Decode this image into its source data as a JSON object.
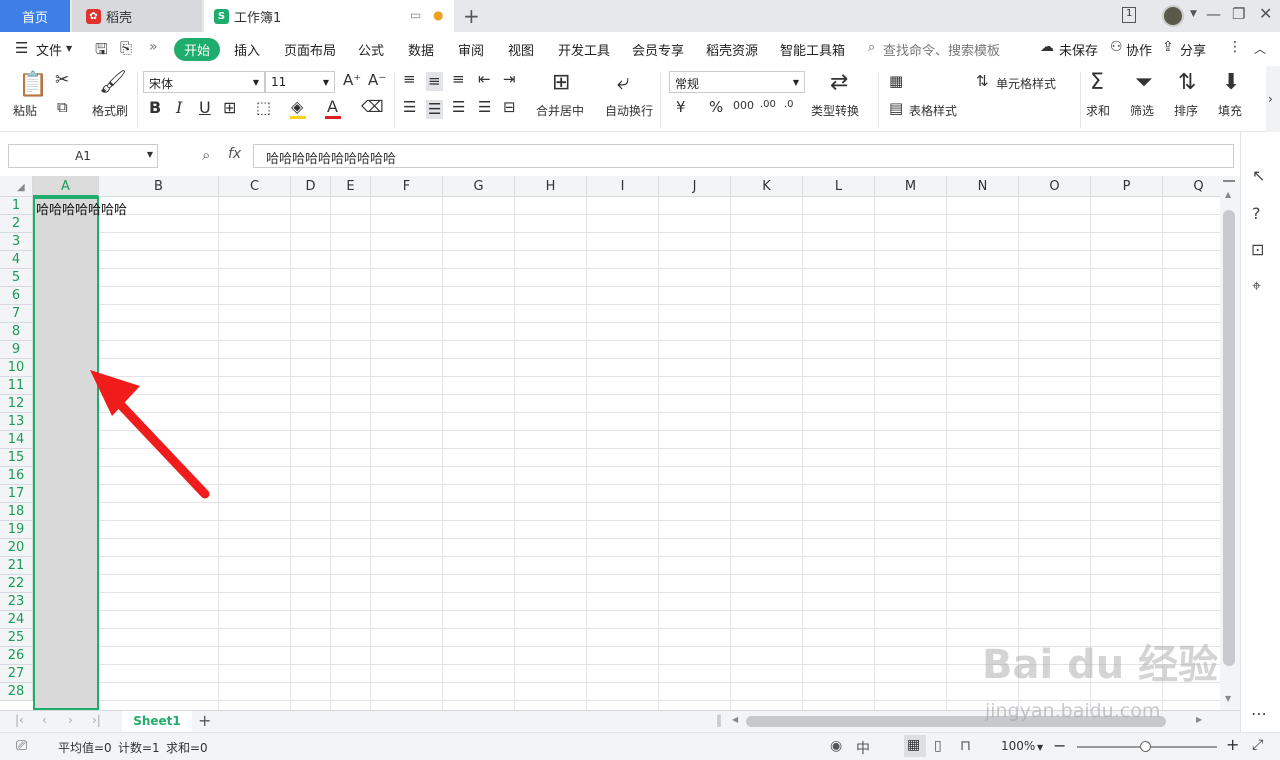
{
  "tabs": {
    "home": "首页",
    "daoke": "稻壳",
    "workbook": "工作簿1"
  },
  "titlebar": {
    "badge": "1"
  },
  "menu": {
    "file": "文件",
    "items": [
      "开始",
      "插入",
      "页面布局",
      "公式",
      "数据",
      "审阅",
      "视图",
      "开发工具",
      "会员专享",
      "稻壳资源",
      "智能工具箱"
    ],
    "search": "查找命令、搜索模板",
    "unsaved": "未保存",
    "collab": "协作",
    "share": "分享"
  },
  "ribbon": {
    "paste": "粘贴",
    "format_painter": "格式刷",
    "font_name": "宋体",
    "font_size": "11",
    "merge": "合并居中",
    "wrap": "自动换行",
    "number_format": "常规",
    "convert": "类型转换",
    "cond_format": "单元格样式",
    "table_style": "表格样式",
    "sum": "求和",
    "filter": "筛选",
    "sort": "排序",
    "fill": "填充",
    "font_color": "#d9201f",
    "fill_color": "#f5d21b"
  },
  "formula_bar": {
    "cell_ref": "A1",
    "fx": "fx",
    "value": "哈哈哈哈哈哈哈哈哈哈"
  },
  "grid": {
    "columns": [
      "A",
      "B",
      "C",
      "D",
      "E",
      "F",
      "G",
      "H",
      "I",
      "J",
      "K",
      "L",
      "M",
      "N",
      "O",
      "P",
      "Q"
    ],
    "rows": [
      "1",
      "2",
      "3",
      "4",
      "5",
      "6",
      "7",
      "8",
      "9",
      "10",
      "11",
      "12",
      "13",
      "14",
      "15",
      "16",
      "17",
      "18",
      "19",
      "20",
      "21",
      "22",
      "23",
      "24",
      "25",
      "26",
      "27",
      "28"
    ],
    "a1_text": "哈哈哈哈哈哈哈",
    "selected_column": "A"
  },
  "sheet_tabs": {
    "active": "Sheet1"
  },
  "status": {
    "avg": "平均值=0",
    "count": "计数=1",
    "sum": "求和=0",
    "zoom": "100%"
  },
  "watermark": {
    "logo": "Bai du 经验",
    "url": "jingyan.baidu.com"
  },
  "accent": "#1ead6c"
}
